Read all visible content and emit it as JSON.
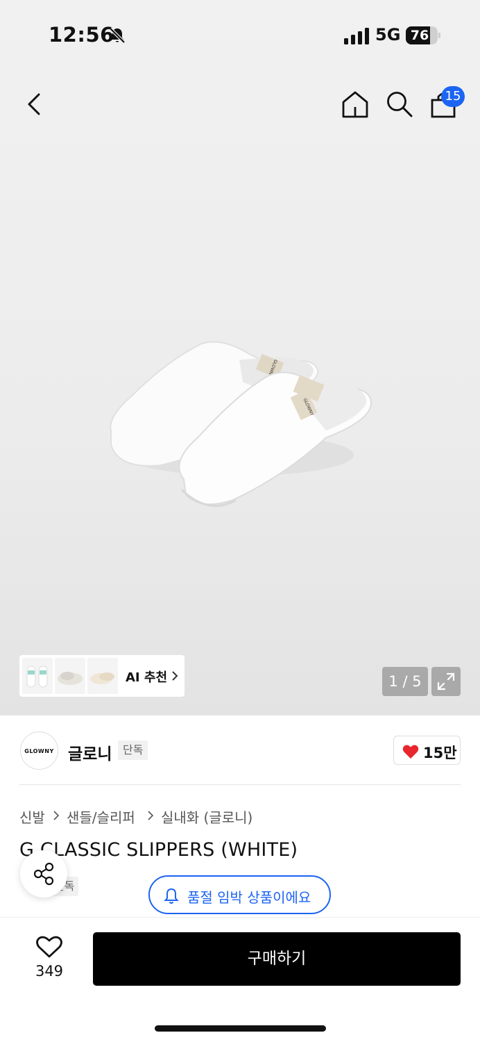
{
  "status_bar": {
    "time": "12:56",
    "network": "5G",
    "battery": "76",
    "battery_level": 0.76
  },
  "header": {
    "cart_count": "15"
  },
  "gallery": {
    "counter": "1 / 5",
    "ai_label": "AI 추천"
  },
  "brand": {
    "logo_text": "GLOWNY",
    "name": "글로니",
    "tag": "단독",
    "likes": "15만"
  },
  "breadcrumb": [
    "신발",
    "샌들/슬리퍼",
    "실내화 (글로니)"
  ],
  "product": {
    "title": "G CLASSIC SLIPPERS (WHITE)",
    "tag": "단독",
    "label_text": "GLOWNY"
  },
  "notice": {
    "soldout_text": "품절 임박 상품이에요"
  },
  "bottom_bar": {
    "wish_count": "349",
    "buy_label": "구매하기"
  },
  "icons": [
    "back-icon",
    "home-icon",
    "search-icon",
    "cart-icon",
    "bell-muted-icon",
    "signal-icon",
    "expand-icon",
    "heart-icon",
    "share-icon",
    "bell-icon",
    "chevron-right-icon"
  ],
  "colors": {
    "accent": "#1c64f2",
    "heart": "#e8262d",
    "buy": "#000000"
  }
}
